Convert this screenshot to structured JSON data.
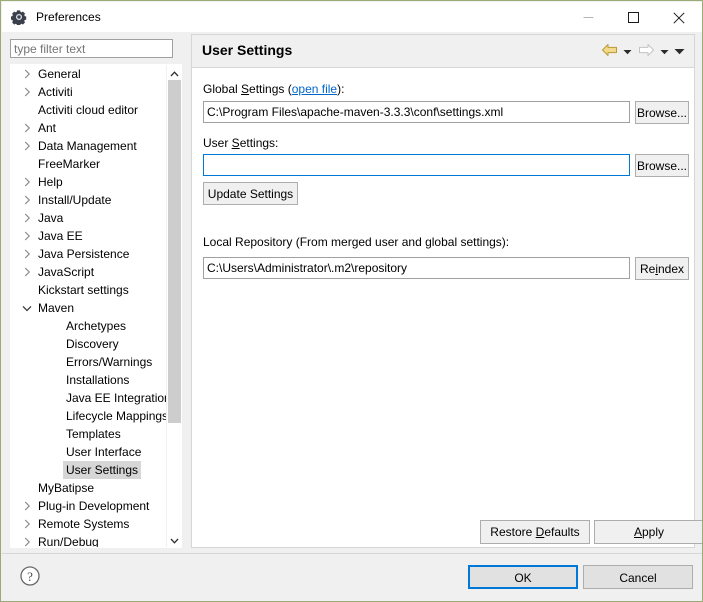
{
  "window": {
    "title": "Preferences",
    "icon": "gear-icon",
    "controls": {
      "minimize": "minimize-icon",
      "maximize": "maximize-icon",
      "close": "close-icon"
    },
    "border_color": "#9aab77"
  },
  "filter": {
    "placeholder": "type filter text",
    "value": ""
  },
  "tree": {
    "items": [
      {
        "label": "General",
        "indent": 0,
        "twisty": "collapsed",
        "selected": false
      },
      {
        "label": "Activiti",
        "indent": 0,
        "twisty": "collapsed",
        "selected": false
      },
      {
        "label": "Activiti cloud editor",
        "indent": 0,
        "twisty": "none",
        "selected": false
      },
      {
        "label": "Ant",
        "indent": 0,
        "twisty": "collapsed",
        "selected": false
      },
      {
        "label": "Data Management",
        "indent": 0,
        "twisty": "collapsed",
        "selected": false
      },
      {
        "label": "FreeMarker",
        "indent": 0,
        "twisty": "none",
        "selected": false
      },
      {
        "label": "Help",
        "indent": 0,
        "twisty": "collapsed",
        "selected": false
      },
      {
        "label": "Install/Update",
        "indent": 0,
        "twisty": "collapsed",
        "selected": false
      },
      {
        "label": "Java",
        "indent": 0,
        "twisty": "collapsed",
        "selected": false
      },
      {
        "label": "Java EE",
        "indent": 0,
        "twisty": "collapsed",
        "selected": false
      },
      {
        "label": "Java Persistence",
        "indent": 0,
        "twisty": "collapsed",
        "selected": false
      },
      {
        "label": "JavaScript",
        "indent": 0,
        "twisty": "collapsed",
        "selected": false
      },
      {
        "label": "Kickstart settings",
        "indent": 0,
        "twisty": "none",
        "selected": false
      },
      {
        "label": "Maven",
        "indent": 0,
        "twisty": "expanded",
        "selected": false
      },
      {
        "label": "Archetypes",
        "indent": 1,
        "twisty": "none",
        "selected": false
      },
      {
        "label": "Discovery",
        "indent": 1,
        "twisty": "none",
        "selected": false
      },
      {
        "label": "Errors/Warnings",
        "indent": 1,
        "twisty": "none",
        "selected": false
      },
      {
        "label": "Installations",
        "indent": 1,
        "twisty": "none",
        "selected": false
      },
      {
        "label": "Java EE Integration",
        "indent": 1,
        "twisty": "none",
        "selected": false
      },
      {
        "label": "Lifecycle Mappings",
        "indent": 1,
        "twisty": "none",
        "selected": false
      },
      {
        "label": "Templates",
        "indent": 1,
        "twisty": "none",
        "selected": false
      },
      {
        "label": "User Interface",
        "indent": 1,
        "twisty": "none",
        "selected": false
      },
      {
        "label": "User Settings",
        "indent": 1,
        "twisty": "none",
        "selected": true
      },
      {
        "label": "MyBatipse",
        "indent": 0,
        "twisty": "none",
        "selected": false
      },
      {
        "label": "Plug-in Development",
        "indent": 0,
        "twisty": "collapsed",
        "selected": false
      },
      {
        "label": "Remote Systems",
        "indent": 0,
        "twisty": "collapsed",
        "selected": false
      },
      {
        "label": "Run/Debug",
        "indent": 0,
        "twisty": "collapsed",
        "selected": false
      }
    ],
    "scrollbar": {
      "up_icon": "chevron-up-icon",
      "down_icon": "chevron-down-icon"
    }
  },
  "content": {
    "title": "User Settings",
    "nav": {
      "back_icon": "back-arrow-icon",
      "back_caret_icon": "chevron-down-icon",
      "forward_icon": "forward-arrow-icon",
      "forward_caret_icon": "chevron-down-icon",
      "menu_caret_icon": "chevron-down-icon"
    },
    "global_settings": {
      "label_prefix": "Global ",
      "label_mnemonic": "S",
      "label_suffix": "ettings (",
      "link": "open file",
      "label_end": "):",
      "value": "C:\\Program Files\\apache-maven-3.3.3\\conf\\settings.xml",
      "browse_label": "Browse..."
    },
    "user_settings": {
      "label_prefix": "User ",
      "label_mnemonic": "S",
      "label_suffix": "ettings:",
      "value": "",
      "focused": true,
      "browse_label": "Browse..."
    },
    "update_button": "Update Settings",
    "local_repository": {
      "label": "Local Repository (From merged user and global settings):",
      "value": "C:\\Users\\Administrator\\.m2\\repository",
      "reindex_prefix": "Re",
      "reindex_mnemonic": "i",
      "reindex_suffix": "ndex"
    },
    "restore_defaults": {
      "prefix": "Restore ",
      "mnemonic": "D",
      "suffix": "efaults"
    },
    "apply": {
      "prefix": "",
      "mnemonic": "A",
      "suffix": "pply"
    }
  },
  "footer": {
    "help_icon": "help-question-icon",
    "ok_label": "OK",
    "cancel_label": "Cancel"
  }
}
